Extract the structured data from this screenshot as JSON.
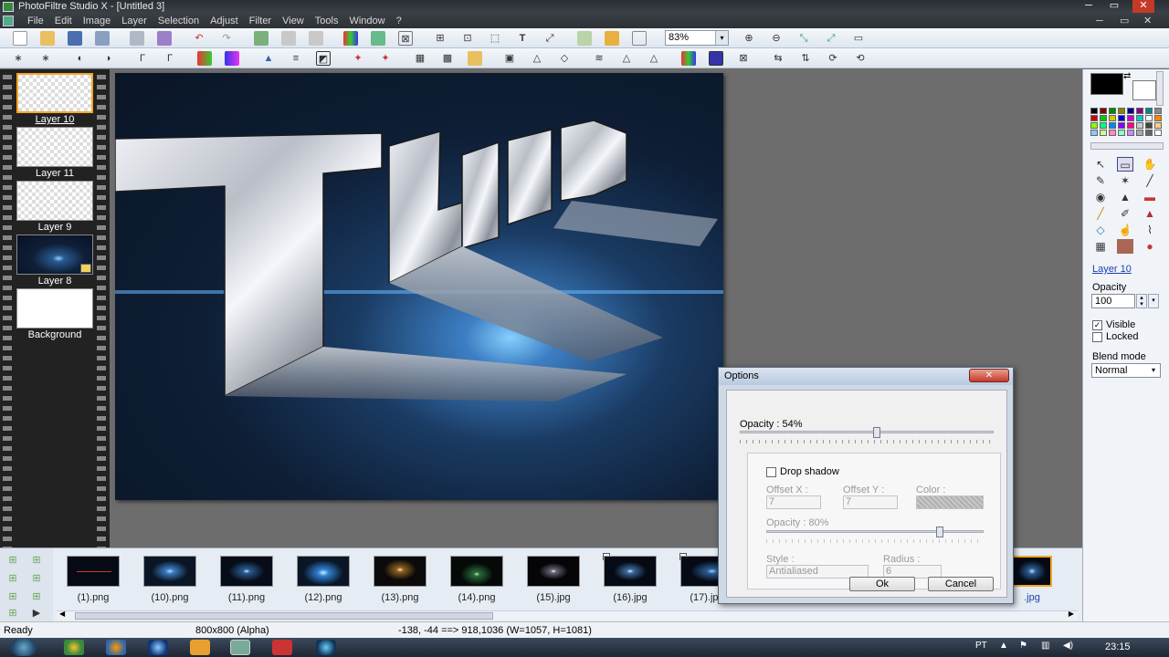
{
  "window": {
    "title": "PhotoFiltre Studio X - [Untitled 3]",
    "btn_min": "─",
    "btn_max": "▭",
    "btn_close": "✕",
    "mdi_min": "─",
    "mdi_max": "▭",
    "mdi_close": "✕"
  },
  "menu": [
    "File",
    "Edit",
    "Image",
    "Layer",
    "Selection",
    "Adjust",
    "Filter",
    "View",
    "Tools",
    "Window",
    "?"
  ],
  "toolbar": {
    "zoom": "83%",
    "zoom_arrow": "▾"
  },
  "layers": [
    {
      "label": "Layer 10",
      "selected": true
    },
    {
      "label": "Layer 11"
    },
    {
      "label": "Layer 9"
    },
    {
      "label": "Layer 8",
      "locked": true
    },
    {
      "label": "Background"
    }
  ],
  "canvas": {
    "text": "ThuuG"
  },
  "right_panel": {
    "layer_name": "Layer 10",
    "opacity_label": "Opacity",
    "opacity_value": "100",
    "visible_label": "Visible",
    "visible_checked": true,
    "locked_label": "Locked",
    "locked_checked": false,
    "blend_label": "Blend mode",
    "blend_value": "Normal",
    "colors": {
      "foreground": "#000000",
      "background": "#ffffff"
    }
  },
  "dialog": {
    "title": "Options",
    "opacity_label": "Opacity : 54%",
    "opacity_value": 54,
    "drop_shadow_label": "Drop shadow",
    "offset_x_label": "Offset X :",
    "offset_x_value": "7",
    "offset_y_label": "Offset Y :",
    "offset_y_value": "7",
    "color_label": "Color :",
    "shadow_opacity_label": "Opacity : 80%",
    "shadow_opacity_value": 80,
    "style_label": "Style :",
    "style_value": "Antialiased",
    "radius_label": "Radius :",
    "radius_value": "6",
    "ok": "Ok",
    "cancel": "Cancel"
  },
  "filmstrip": [
    "(1).png",
    "(10).png",
    "(11).png",
    "(12).png",
    "(13).png",
    "(14).png",
    "(15).jpg",
    "(16).jpg",
    "(17).jpg"
  ],
  "filmstrip_partial": ".jpg",
  "status": {
    "ready": "Ready",
    "size": "800x800 (Alpha)",
    "coords": "-138, -44 ==> 918,1036 (W=1057, H=1081)"
  },
  "taskbar": {
    "lang": "PT",
    "time": "23:15"
  }
}
